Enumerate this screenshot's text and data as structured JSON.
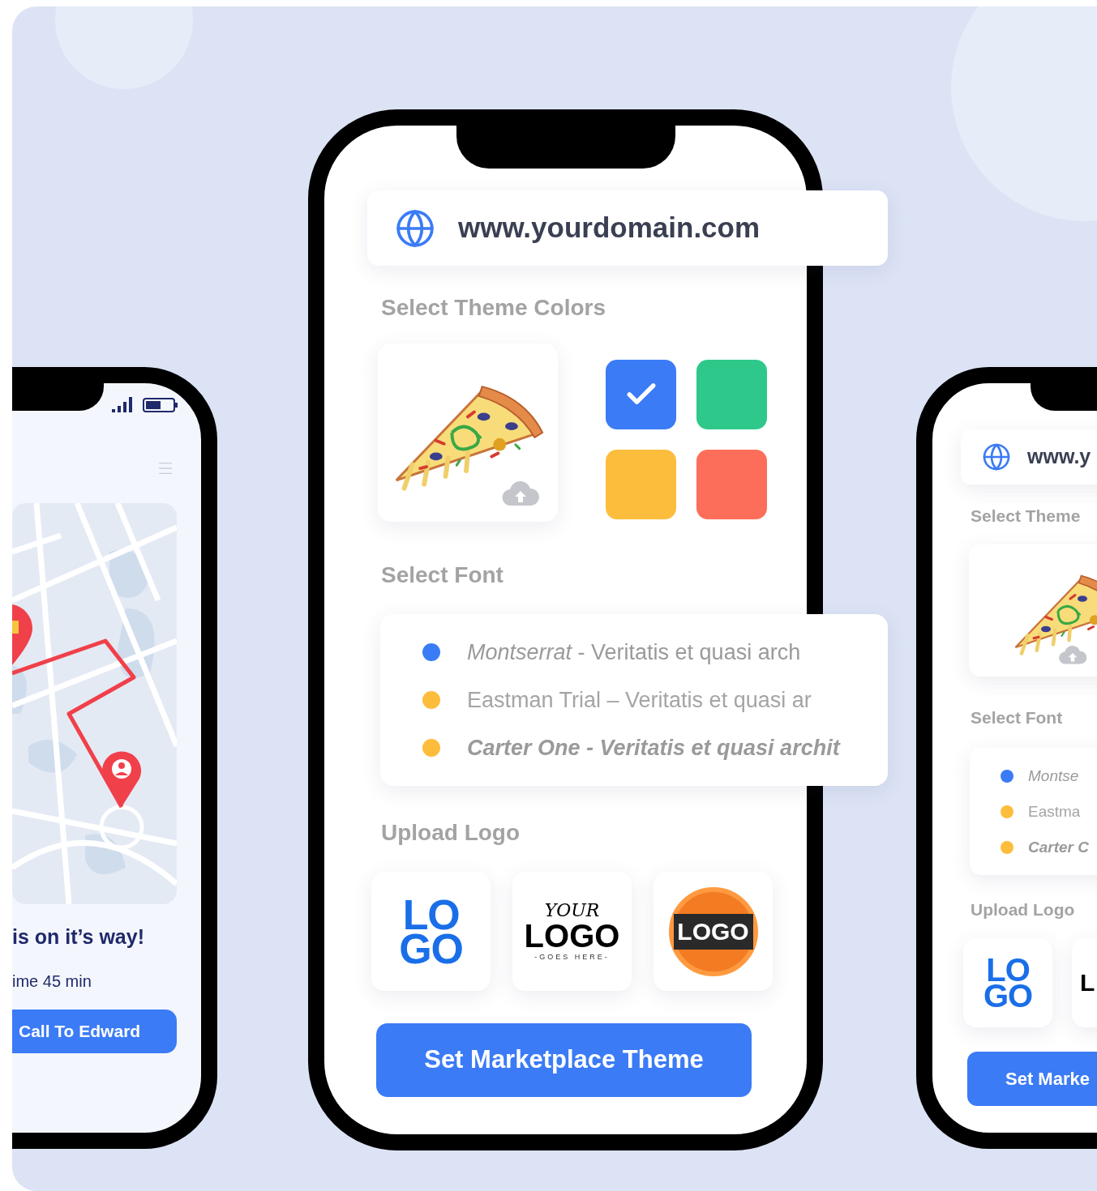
{
  "left_phone": {
    "headline": "is on it’s way!",
    "eta": "ime 45 min",
    "button": "Call To Edward"
  },
  "center_phone": {
    "url": "www.yourdomain.com",
    "theme_heading": "Select Theme Colors",
    "swatches": [
      {
        "color": "#3b7bf6",
        "selected": true
      },
      {
        "color": "#2ec98a",
        "selected": false
      },
      {
        "color": "#fdbd3c",
        "selected": false
      },
      {
        "color": "#fd6e5a",
        "selected": false
      }
    ],
    "font_heading": "Select Font",
    "fonts": [
      {
        "kind": "mixed",
        "text": "*Montserrat* - Veritatis et quasi arch",
        "selected": true
      },
      {
        "kind": "plain",
        "text": "Eastman Trial – Veritatis et quasi ar",
        "selected": false
      },
      {
        "kind": "bold-italic",
        "text": "Carter One - Veritatis et quasi archit",
        "selected": false
      }
    ],
    "logo_heading": "Upload Logo",
    "logos": [
      {
        "kind": "stacked",
        "lines": [
          {
            "text": "LO"
          },
          {
            "text": "GO"
          }
        ]
      },
      {
        "kind": "script",
        "lines": [
          {
            "kind": "top",
            "text": "YOUR"
          },
          {
            "kind": "main",
            "text": "LOGO"
          },
          {
            "kind": "tagline",
            "text": "-GOES HERE-"
          }
        ]
      },
      {
        "kind": "badge",
        "lines": [
          {
            "text": "LOGO"
          }
        ]
      }
    ],
    "button": "Set Marketplace Theme"
  },
  "right_phone": {
    "url": "www.y",
    "theme_heading": "Select Theme",
    "font_heading": "Select Font",
    "fonts": [
      {
        "kind": "italic",
        "text": "Montse",
        "selected": true
      },
      {
        "kind": "plain",
        "text": "Eastma",
        "selected": false
      },
      {
        "kind": "bold-italic",
        "text": "Carter C",
        "selected": false
      }
    ],
    "logo_heading": "Upload Logo",
    "logos": [
      {
        "kind": "stacked",
        "lines": [
          {
            "text": "LO"
          },
          {
            "text": "GO"
          }
        ]
      },
      {
        "kind": "script",
        "lines": [
          {
            "kind": "main",
            "text": "L"
          }
        ]
      }
    ],
    "button": "Set Marke"
  }
}
